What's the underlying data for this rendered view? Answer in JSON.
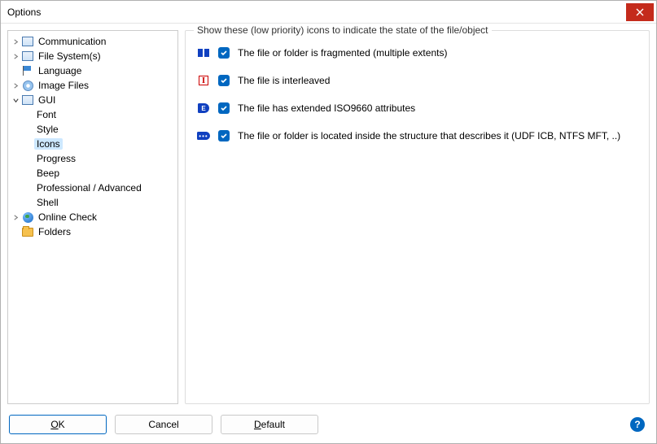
{
  "window": {
    "title": "Options"
  },
  "tree": {
    "items": [
      {
        "label": "Communication",
        "icon": "generic",
        "expandable": true,
        "expanded": false
      },
      {
        "label": "File System(s)",
        "icon": "generic",
        "expandable": true,
        "expanded": false
      },
      {
        "label": "Language",
        "icon": "flag",
        "expandable": false
      },
      {
        "label": "Image Files",
        "icon": "disc",
        "expandable": true,
        "expanded": false
      },
      {
        "label": "GUI",
        "icon": "generic",
        "expandable": true,
        "expanded": true,
        "children": [
          {
            "label": "Font"
          },
          {
            "label": "Style"
          },
          {
            "label": "Icons",
            "selected": true
          },
          {
            "label": "Progress"
          },
          {
            "label": "Beep"
          },
          {
            "label": "Professional / Advanced"
          },
          {
            "label": "Shell"
          }
        ]
      },
      {
        "label": "Online Check",
        "icon": "globe",
        "expandable": true,
        "expanded": false
      },
      {
        "label": "Folders",
        "icon": "folder",
        "expandable": false
      }
    ]
  },
  "group": {
    "title": "Show these (low priority) icons to indicate the state of the file/object",
    "options": [
      {
        "checked": true,
        "label": "The file or folder is fragmented (multiple extents)",
        "icon": "frag"
      },
      {
        "checked": true,
        "label": "The file is interleaved",
        "icon": "inter"
      },
      {
        "checked": true,
        "label": "The file has extended ISO9660 attributes",
        "icon": "ext"
      },
      {
        "checked": true,
        "label": "The file or folder is located inside the structure that describes it (UDF ICB, NTFS MFT, ..)",
        "icon": "loc"
      }
    ]
  },
  "buttons": {
    "ok": "OK",
    "cancel": "Cancel",
    "default": "Default"
  },
  "help": "?"
}
